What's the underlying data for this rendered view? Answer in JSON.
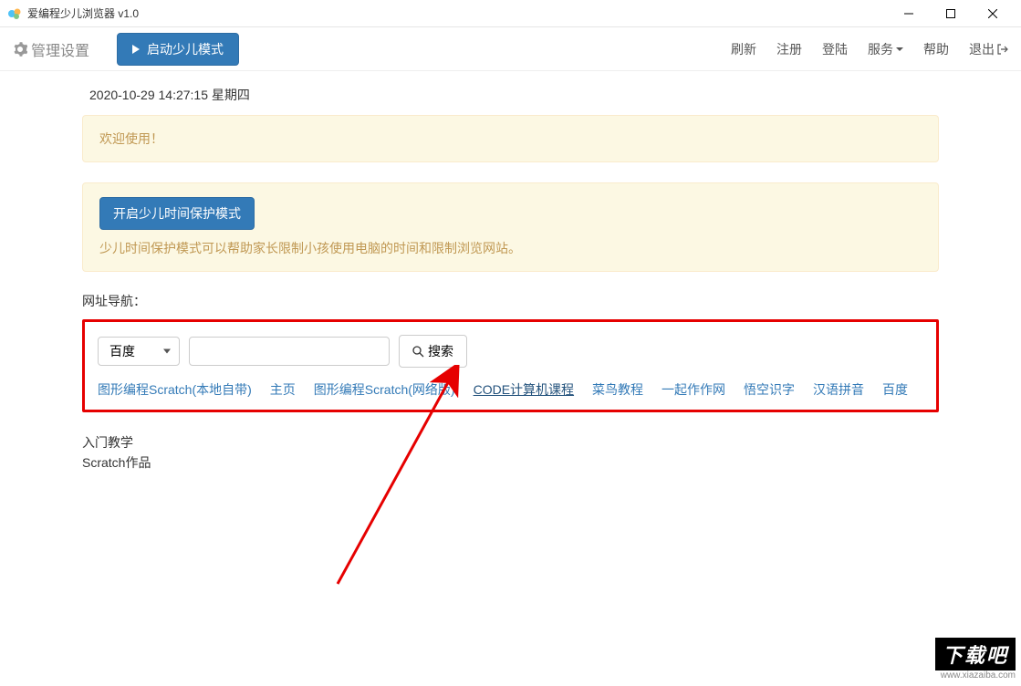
{
  "window": {
    "title": "爱编程少儿浏览器 v1.0"
  },
  "toolbar": {
    "settings_label": "管理设置",
    "launch_label": "启动少儿模式"
  },
  "nav": {
    "refresh": "刷新",
    "register": "注册",
    "login": "登陆",
    "service": "服务",
    "help": "帮助",
    "exit": "退出"
  },
  "datetime": "2020-10-29 14:27:15 星期四",
  "welcome_text": "欢迎使用！",
  "protect": {
    "button": "开启少儿时间保护模式",
    "desc": "少儿时间保护模式可以帮助家长限制小孩使用电脑的时间和限制浏览网站。"
  },
  "nav_section_label": "网址导航：",
  "search": {
    "engine_selected": "百度",
    "input_value": "",
    "button_label": "搜索"
  },
  "quick_links": [
    "图形编程Scratch(本地自带)",
    "主页",
    "图形编程Scratch(网络版)",
    "CODE计算机课程",
    "菜鸟教程",
    "一起作作网",
    "悟空识字",
    "汉语拼音",
    "百度"
  ],
  "bottom": {
    "tutorial": "入门教学",
    "works": "Scratch作品"
  },
  "watermark": {
    "text": "下载吧",
    "url": "www.xiazaiba.com"
  }
}
